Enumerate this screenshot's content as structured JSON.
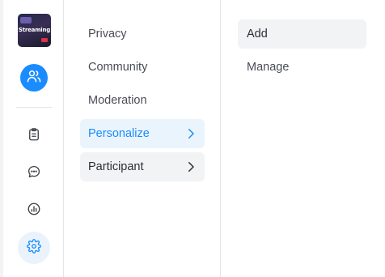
{
  "app": {
    "logo_text": "Streaming"
  },
  "rail": {
    "items": [
      {
        "icon": "users-icon"
      },
      {
        "icon": "clipboard-icon"
      },
      {
        "icon": "chat-icon"
      },
      {
        "icon": "analytics-icon"
      },
      {
        "icon": "gear-icon"
      }
    ]
  },
  "menu": {
    "items": [
      {
        "label": "Privacy"
      },
      {
        "label": "Community"
      },
      {
        "label": "Moderation"
      },
      {
        "label": "Personalize"
      },
      {
        "label": "Participant"
      }
    ]
  },
  "submenu": {
    "items": [
      {
        "label": "Add"
      },
      {
        "label": "Manage"
      }
    ]
  },
  "colors": {
    "accent": "#1a8cff",
    "selected_bg": "#eaf4fd",
    "hover_bg": "#f2f3f5"
  }
}
